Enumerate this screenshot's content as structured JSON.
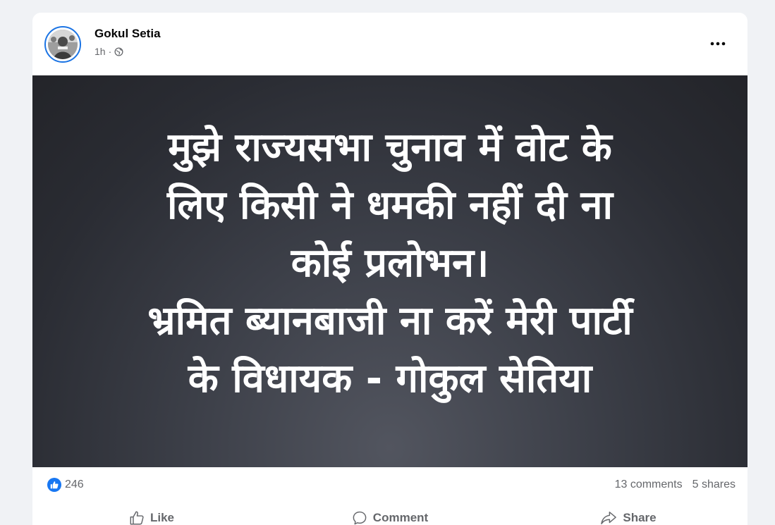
{
  "post": {
    "author": "Gokul Setia",
    "time": "1h",
    "separator": "·",
    "privacy_icon": "globe-icon",
    "more_icon": "more-horizontal-icon"
  },
  "image": {
    "lines": [
      "मुझे राज्यसभा चुनाव में वोट के",
      "लिए किसी ने धमकी नहीं दी ना",
      "कोई प्रलोभन।",
      "भ्रमित ब्यानबाजी ना करें मेरी पार्टी",
      "के विधायक - गोकुल सेतिया"
    ],
    "background_color": "#2f3138",
    "text_color": "#ffffff"
  },
  "stats": {
    "reaction_icon": "like-reaction-icon",
    "reaction_count": "246",
    "comments": "13 comments",
    "shares": "5 shares"
  },
  "actions": {
    "like": "Like",
    "comment": "Comment",
    "share": "Share"
  },
  "colors": {
    "accent": "#1877f2",
    "secondary_text": "#65676b",
    "page_background": "#f0f2f5"
  }
}
